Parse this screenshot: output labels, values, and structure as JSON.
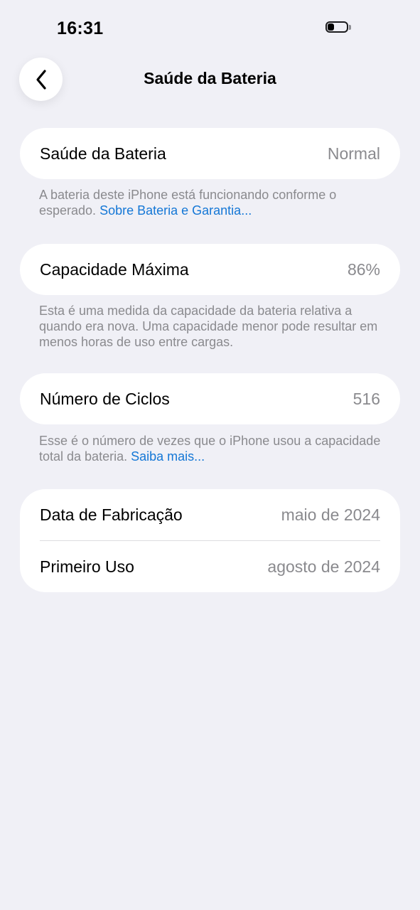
{
  "status": {
    "time": "16:31",
    "battery_level": 0.35
  },
  "nav": {
    "title": "Saúde da Bateria"
  },
  "sections": {
    "health": {
      "label": "Saúde da Bateria",
      "value": "Normal",
      "footer_text": "A bateria deste iPhone está funcionando conforme o esperado.",
      "footer_link": "Sobre Bateria e Garantia..."
    },
    "capacity": {
      "label": "Capacidade Máxima",
      "value": "86%",
      "footer_text": "Esta é uma medida da capacidade da bateria relativa a quando era nova. Uma capacidade menor pode resultar em menos horas de uso entre cargas."
    },
    "cycles": {
      "label": "Número de Ciclos",
      "value": "516",
      "footer_text": "Esse é o número de vezes que o iPhone usou a capacidade total da bateria.",
      "footer_link": "Saiba mais..."
    },
    "dates": {
      "manufacture_label": "Data de Fabricação",
      "manufacture_value": "maio de 2024",
      "first_use_label": "Primeiro Uso",
      "first_use_value": "agosto de 2024"
    }
  },
  "colors": {
    "background": "#F0F0F6",
    "link": "#1477D6",
    "secondary_text": "#8A8A8E"
  },
  "icons": {
    "back": "chevron-left-icon",
    "battery": "battery-icon"
  }
}
